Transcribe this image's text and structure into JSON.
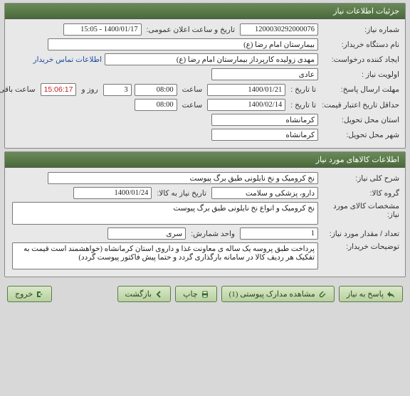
{
  "panels": {
    "niaz": {
      "title": "جزئیات اطلاعات نیاز",
      "fields": {
        "shmare_niaz_lbl": "شماره نیاز:",
        "shmare_niaz": "1200030292000076",
        "tarikh_elen_lbl": "تاریخ و ساعت اعلان عمومی:",
        "tarikh_elen": "1400/01/17 - 15:05",
        "nam_dastgah_lbl": "نام دستگاه خریدار:",
        "nam_dastgah": "بیمارستان امام رضا (ع)",
        "ijad_lbl": "ایجاد کننده درخواست:",
        "ijad": "مهدی زولیده کارپرداز بیمارستان امام رضا (ع)",
        "tamas_link": "اطلاعات تماس خریدار",
        "olaviat_lbl": "اولویت نیاز :",
        "olaviat": "عادی",
        "mohlat_lbl": "مهلت ارسال پاسخ:",
        "ta_tarikh_lbl": "تا تاریخ :",
        "mohlat_tarikh": "1400/01/21",
        "saat_lbl": "ساعت",
        "mohlat_saat": "08:00",
        "rooz": "3",
        "rooz_lbl": "روز و",
        "countdown": "15:06:17",
        "mande_lbl": "ساعت باقی مانده",
        "hadaqal_lbl": "حداقل تاریخ اعتبار قیمت:",
        "hadaqal_tarikh": "1400/02/14",
        "hadaqal_saat": "08:00",
        "ostan_lbl": "استان محل تحویل:",
        "ostan": "کرمانشاه",
        "shahr_lbl": "شهر محل تحویل:",
        "shahr": "کرمانشاه"
      }
    },
    "kala": {
      "title": "اطلاعات کالاهای مورد نیاز",
      "fields": {
        "sharh_lbl": "شرح کلی نیاز:",
        "sharh": "نخ کرومیک و نخ نایلونی طبق برگ پیوست",
        "gorouh_lbl": "گروه کالا:",
        "gorouh": "دارو، پزشکی و سلامت",
        "tarikh_kala_lbl": "تاریخ نیاز به کالا:",
        "tarikh_kala": "1400/01/24",
        "moshakhasat_lbl": "مشخصات کالای مورد نیاز:",
        "moshakhasat": "نخ کرومیک و انواع نخ نایلونی طبق برگ پیوست",
        "tedad_lbl": "تعداد / مقدار مورد نیاز:",
        "tedad": "1",
        "vahed_lbl": "واحد شمارش:",
        "vahed": "سری",
        "tozih_lbl": "توضیحات خریدار:",
        "tozih": "پرداخت طبق پروسه یک ساله ی معاونت غذا و داروی استان کرمانشاه (خواهشمند است قیمت به تفکیک هر ردیف کالا در سامانه بارگذاری گردد و حتما پیش فاکتور پیوست گردد)"
      }
    }
  },
  "buttons": {
    "pasokh": "پاسخ به نیاز",
    "madarek": "مشاهده مدارک پیوستی (1)",
    "chap": "چاپ",
    "bazgasht": "بازگشت",
    "khorouj": "خروج"
  }
}
